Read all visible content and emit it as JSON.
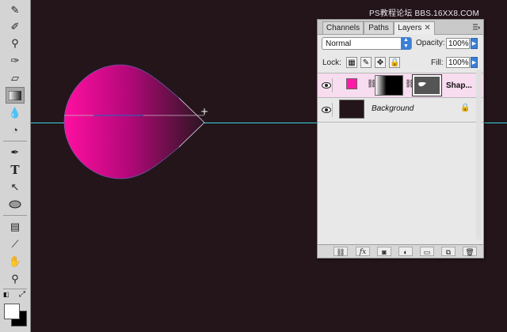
{
  "watermark": {
    "text": "PS教程论坛 BBS.16XX8.COM"
  },
  "toolbox": {
    "tools": [
      {
        "name": "healing-brush-tool",
        "glyph": "✎"
      },
      {
        "name": "brush-tool",
        "glyph": "✐"
      },
      {
        "name": "clone-stamp-tool",
        "glyph": "⛫"
      },
      {
        "name": "history-brush-tool",
        "glyph": "✑"
      },
      {
        "name": "eraser-tool",
        "glyph": "▱"
      },
      {
        "name": "gradient-tool",
        "glyph": "▤"
      },
      {
        "name": "blur-tool",
        "glyph": "💧"
      },
      {
        "name": "dodge-tool",
        "glyph": "◔"
      },
      {
        "name": "pen-tool",
        "glyph": "✒"
      },
      {
        "name": "type-tool",
        "glyph": "T"
      },
      {
        "name": "path-selection-tool",
        "glyph": "↖"
      },
      {
        "name": "ellipse-tool",
        "glyph": "⬭"
      },
      {
        "name": "notes-tool",
        "glyph": "▭"
      },
      {
        "name": "eyedropper-tool",
        "glyph": "⟋"
      },
      {
        "name": "hand-tool",
        "glyph": "✋"
      },
      {
        "name": "zoom-tool",
        "glyph": "🔍"
      }
    ],
    "active_tool": "gradient-tool",
    "foreground_color": "#ffffff",
    "background_color": "#000000"
  },
  "layers_panel": {
    "tabs": [
      {
        "label": "Channels"
      },
      {
        "label": "Paths"
      },
      {
        "label": "Layers"
      }
    ],
    "active_tab": "Layers",
    "blend_mode": "Normal",
    "opacity_label": "Opacity:",
    "opacity_value": "100%",
    "lock_label": "Lock:",
    "fill_label": "Fill:",
    "fill_value": "100%",
    "layers": [
      {
        "name": "Shap...",
        "selected": true,
        "fill_color": "#ff1aa8"
      },
      {
        "name": "Background",
        "selected": false,
        "fill_color": "#231519",
        "locked": true
      }
    ]
  },
  "canvas": {
    "background": "#231519",
    "shape_gradient_start": "#ff0fa0",
    "shape_gradient_end": "#2a1520"
  }
}
